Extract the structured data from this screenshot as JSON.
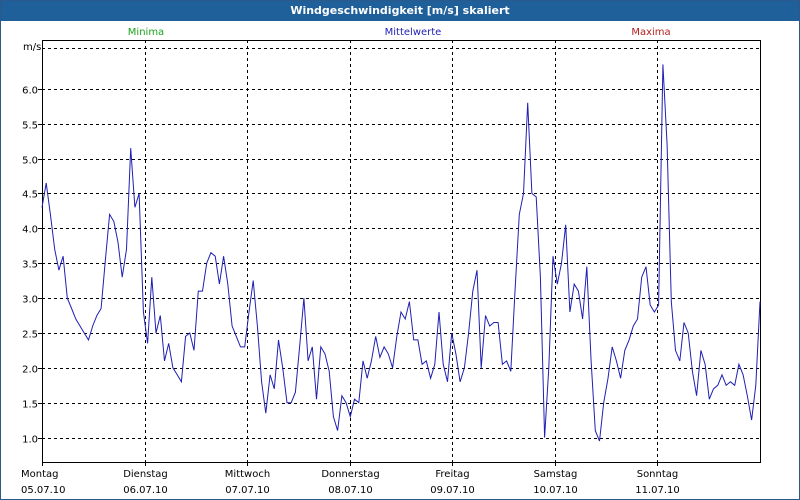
{
  "window": {
    "title": "Windgeschwindigkeit [m/s] skaliert"
  },
  "legend": [
    {
      "label": "Minima",
      "color": "#1aa31a"
    },
    {
      "label": "Mittelwerte",
      "color": "#1f1fb4"
    },
    {
      "label": "Maxima",
      "color": "#b41f1f"
    }
  ],
  "chart_data": {
    "type": "line",
    "title": "Windgeschwindigkeit [m/s] skaliert",
    "ylabel": "m/s",
    "ylim": [
      0.65,
      6.7
    ],
    "yticks": [
      1.0,
      1.5,
      2.0,
      2.5,
      3.0,
      3.5,
      4.0,
      4.5,
      5.0,
      5.5,
      6.0
    ],
    "xlim": [
      0,
      7.0
    ],
    "x_ticks": [
      {
        "x": 0,
        "day": "Montag",
        "date": "05.07.10"
      },
      {
        "x": 1,
        "day": "Dienstag",
        "date": "06.07.10"
      },
      {
        "x": 2,
        "day": "Mittwoch",
        "date": "07.07.10"
      },
      {
        "x": 3,
        "day": "Donnerstag",
        "date": "08.07.10"
      },
      {
        "x": 4,
        "day": "Freitag",
        "date": "09.07.10"
      },
      {
        "x": 5,
        "day": "Samstag",
        "date": "10.07.10"
      },
      {
        "x": 6,
        "day": "Sonntag",
        "date": "11.07.10"
      }
    ],
    "grid": true,
    "series": [
      {
        "name": "Mittelwerte",
        "color": "#1f1fb4",
        "values": [
          4.3,
          4.65,
          4.2,
          3.7,
          3.4,
          3.6,
          3.0,
          2.85,
          2.7,
          2.6,
          2.5,
          2.4,
          2.6,
          2.75,
          2.85,
          3.55,
          4.2,
          4.1,
          3.8,
          3.3,
          3.7,
          5.15,
          4.3,
          4.5,
          2.8,
          2.35,
          3.3,
          2.5,
          2.75,
          2.1,
          2.35,
          2.0,
          1.9,
          1.8,
          2.45,
          2.5,
          2.25,
          3.1,
          3.1,
          3.5,
          3.65,
          3.6,
          3.2,
          3.6,
          3.2,
          2.6,
          2.45,
          2.3,
          2.3,
          2.8,
          3.25,
          2.6,
          1.8,
          1.35,
          1.9,
          1.7,
          2.4,
          2.0,
          1.5,
          1.5,
          1.65,
          2.3,
          3.0,
          2.1,
          2.3,
          1.55,
          2.3,
          2.2,
          1.95,
          1.3,
          1.1,
          1.6,
          1.5,
          1.3,
          1.55,
          1.5,
          2.1,
          1.85,
          2.1,
          2.45,
          2.15,
          2.3,
          2.2,
          2.0,
          2.45,
          2.8,
          2.7,
          2.95,
          2.4,
          2.4,
          2.05,
          2.1,
          1.85,
          2.05,
          2.8,
          2.05,
          1.8,
          2.5,
          2.2,
          1.8,
          2.0,
          2.5,
          3.1,
          3.4,
          2.0,
          2.75,
          2.6,
          2.65,
          2.65,
          2.05,
          2.1,
          1.95,
          3.1,
          4.2,
          4.5,
          5.8,
          4.5,
          4.45,
          3.3,
          1.0,
          2.0,
          3.6,
          3.2,
          3.5,
          4.05,
          2.8,
          3.2,
          3.1,
          2.7,
          3.45,
          2.1,
          1.1,
          0.95,
          1.5,
          1.85,
          2.3,
          2.1,
          1.85,
          2.25,
          2.4,
          2.6,
          2.7,
          3.3,
          3.45,
          2.9,
          2.8,
          2.9,
          6.35,
          5.2,
          2.95,
          2.25,
          2.1,
          2.65,
          2.5,
          1.95,
          1.6,
          2.25,
          2.05,
          1.55,
          1.7,
          1.75,
          1.9,
          1.75,
          1.8,
          1.75,
          2.05,
          1.9,
          1.6,
          1.25,
          1.75,
          2.95
        ]
      }
    ]
  }
}
